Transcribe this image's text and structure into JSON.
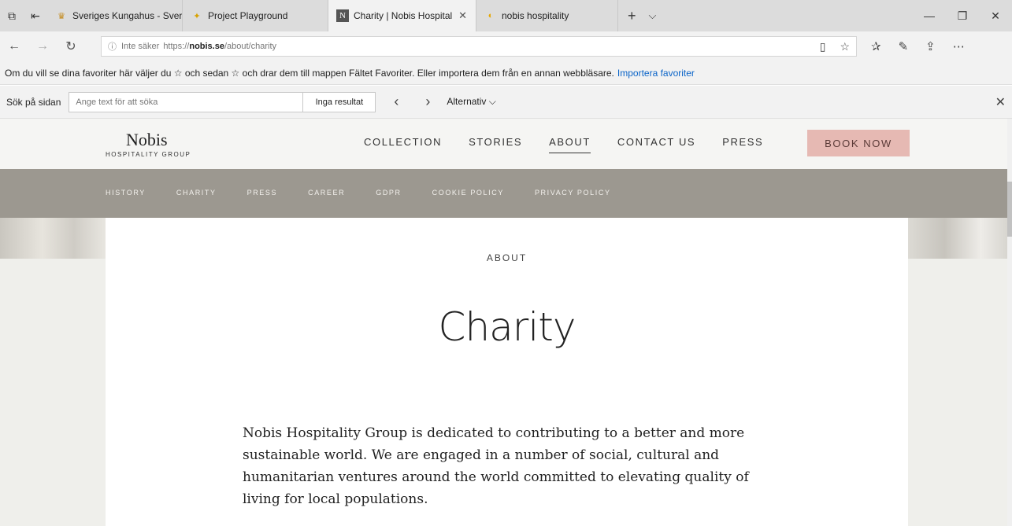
{
  "browser": {
    "tabs": [
      {
        "label": "Sveriges Kungahus - Sverige",
        "icon": "crown-icon"
      },
      {
        "label": "Project Playground",
        "icon": "star-icon"
      },
      {
        "label": "Charity | Nobis Hospital",
        "icon": "n-logo-icon",
        "active": true
      },
      {
        "label": "nobis hospitality",
        "icon": "bing-icon"
      }
    ],
    "url_prefix": "Inte säker",
    "url_scheme": "https://",
    "url_host": "nobis.se",
    "url_path": "/about/charity",
    "favorites_text": "Om du vill se dina favoriter här väljer du ☆ och sedan ☆ och drar dem till mappen Fältet Favoriter. Eller importera dem från en annan webbläsare.",
    "favorites_link": "Importera favoriter",
    "find_label": "Sök på sidan",
    "find_placeholder": "Ange text för att söka",
    "find_result": "Inga resultat",
    "find_options": "Alternativ"
  },
  "site": {
    "logo_name": "Nobis",
    "logo_sub": "HOSPITALITY GROUP",
    "nav": [
      "COLLECTION",
      "STORIES",
      "ABOUT",
      "CONTACT US",
      "PRESS"
    ],
    "book": "BOOK NOW",
    "subnav": [
      "HISTORY",
      "CHARITY",
      "PRESS",
      "CAREER",
      "GDPR",
      "COOKIE POLICY",
      "PRIVACY POLICY"
    ],
    "eyebrow": "ABOUT",
    "title": "Charity",
    "body": "Nobis Hospitality Group is dedicated to contributing to a better and more sustainable world. We are engaged in a number of social, cultural and humanitarian ventures around the world committed to elevating quality of living for local populations."
  },
  "colors": {
    "book_button": "#e6b9b3",
    "subnav_bg": "#9c9890",
    "link": "#0a64c8"
  }
}
